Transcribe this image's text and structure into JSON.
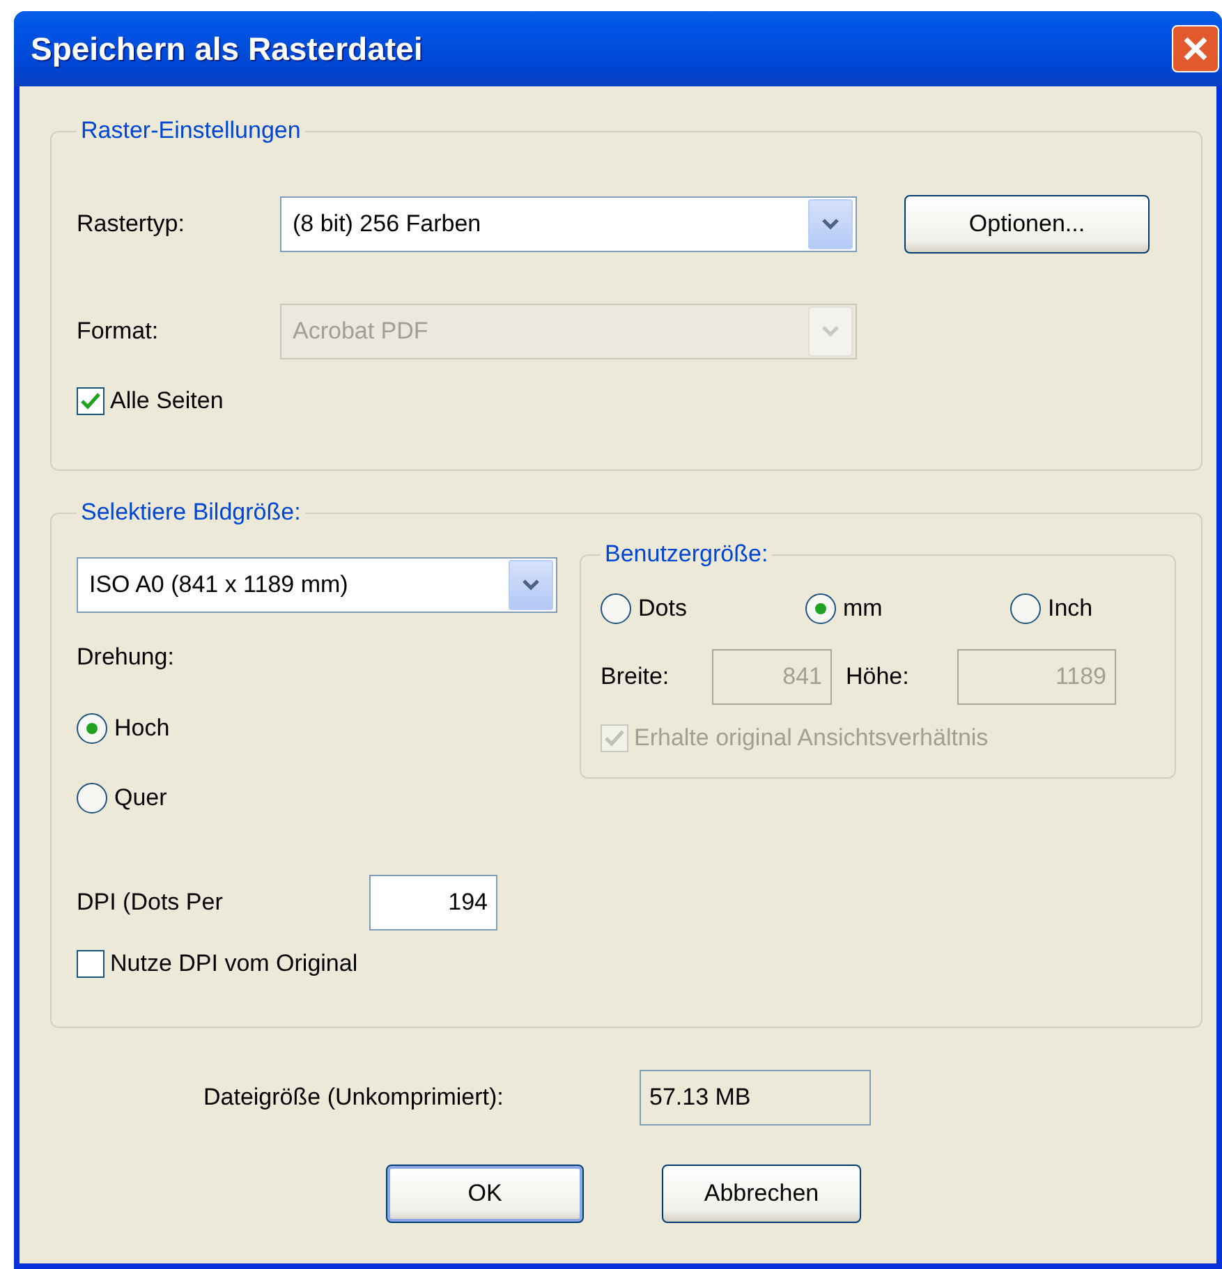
{
  "window": {
    "title": "Speichern als Rasterdatei"
  },
  "raster_settings": {
    "legend": "Raster-Einstellungen",
    "raster_type": {
      "label": "Rastertyp:",
      "value": "(8 bit) 256 Farben",
      "disabled": false
    },
    "options_button": "Optionen...",
    "format": {
      "label": "Format:",
      "value": "Acrobat PDF",
      "disabled": true
    },
    "all_pages": {
      "label": "Alle Seiten",
      "checked": true,
      "disabled": false
    }
  },
  "image_size": {
    "legend": "Selektiere Bildgröße:",
    "size": {
      "value": "ISO A0  (841 x 1189 mm)",
      "disabled": false
    },
    "rotation": {
      "label": "Drehung:",
      "options": [
        {
          "label": "Hoch",
          "selected": true
        },
        {
          "label": "Quer",
          "selected": false
        }
      ]
    },
    "dpi": {
      "label": "DPI (Dots Per",
      "value": "194"
    },
    "use_original_dpi": {
      "label": "Nutze DPI vom Original",
      "checked": false,
      "disabled": false
    },
    "custom_size": {
      "legend": "Benutzergröße:",
      "units": [
        {
          "label": "Dots",
          "selected": false
        },
        {
          "label": "mm",
          "selected": true
        },
        {
          "label": "Inch",
          "selected": false
        }
      ],
      "width": {
        "label": "Breite:",
        "value": "841",
        "disabled": true
      },
      "height": {
        "label": "Höhe:",
        "value": "1189",
        "disabled": true
      },
      "keep_ratio": {
        "label": "Erhalte original Ansichtsverhältnis",
        "checked": true,
        "disabled": true
      }
    }
  },
  "file_size": {
    "label": "Dateigröße (Unkomprimiert):",
    "value": "57.13 MB"
  },
  "buttons": [
    {
      "label": "OK",
      "default": true
    },
    {
      "label": "Abbrechen",
      "default": false
    }
  ]
}
